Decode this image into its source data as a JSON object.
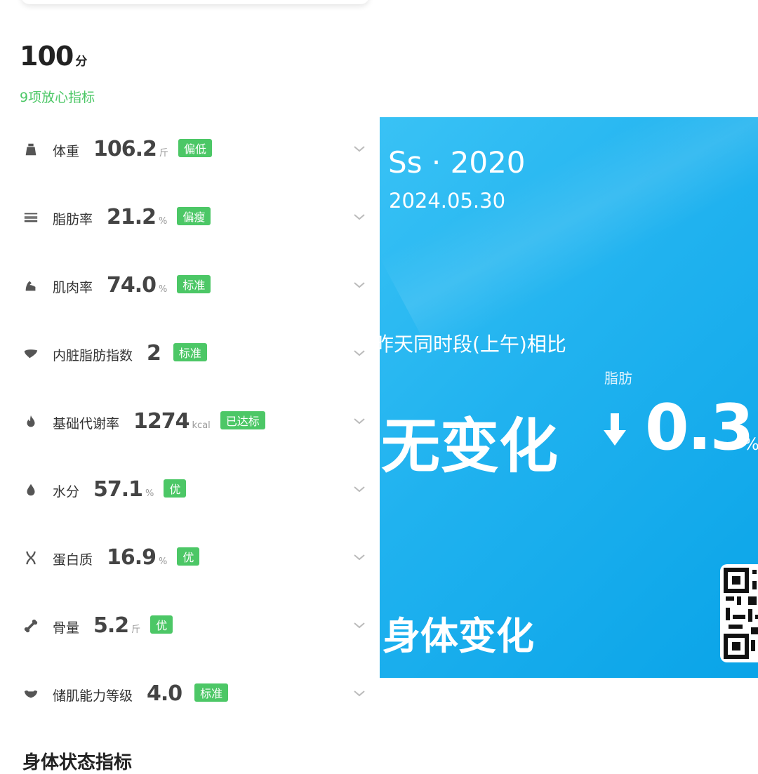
{
  "score": {
    "value": "100",
    "unit": "分"
  },
  "subtitle": "9项放心指标",
  "metrics": [
    {
      "icon": "weight-icon",
      "name": "体重",
      "value": "106.2",
      "unit": "斤",
      "badge": "偏低"
    },
    {
      "icon": "body-fat-icon",
      "name": "脂肪率",
      "value": "21.2",
      "unit": "%",
      "badge": "偏瘦"
    },
    {
      "icon": "muscle-icon",
      "name": "肌肉率",
      "value": "74.0",
      "unit": "%",
      "badge": "标准"
    },
    {
      "icon": "liver-icon",
      "name": "内脏脂肪指数",
      "value": "2",
      "unit": "",
      "badge": "标准"
    },
    {
      "icon": "flame-icon",
      "name": "基础代谢率",
      "value": "1274",
      "unit": "kcal",
      "badge": "已达标"
    },
    {
      "icon": "water-drop-icon",
      "name": "水分",
      "value": "57.1",
      "unit": "%",
      "badge": "优"
    },
    {
      "icon": "dna-icon",
      "name": "蛋白质",
      "value": "16.9",
      "unit": "%",
      "badge": "优"
    },
    {
      "icon": "bone-icon",
      "name": "骨量",
      "value": "5.2",
      "unit": "斤",
      "badge": "优"
    },
    {
      "icon": "muscle-storage-icon",
      "name": "储肌能力等级",
      "value": "4.0",
      "unit": "",
      "badge": "标准"
    }
  ],
  "bottom_title": "身体状态指标",
  "overlay": {
    "title": "Ss · 2020",
    "date": "2024.05.30",
    "compare_text": "昨天同时段(上午)相比",
    "fat_label": "脂肪",
    "no_change": "无变化",
    "delta_value": "0.3",
    "delta_unit": "%",
    "body_change": "身体变化"
  },
  "colors": {
    "accent_green": "#4cc766",
    "overlay_blue": "#20b2ef"
  }
}
